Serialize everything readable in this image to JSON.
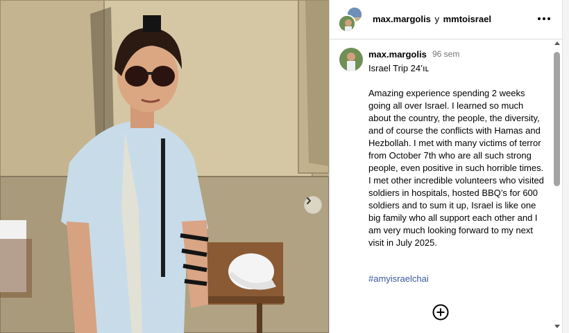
{
  "header": {
    "user1": "max.margolis",
    "conjunction": "y",
    "user2": "mmtoisrael"
  },
  "post": {
    "author": "max.margolis",
    "time": "96 sem",
    "title": "Israel Trip 24’ıʟ",
    "body": "Amazing experience spending 2 weeks going all over Israel. I learned so much about the country, the people, the diversity, and of course the conflicts with Hamas and Hezbollah. I met with many victims of terror from October 7th who are all such strong people, even positive in such horrible times. I met other incredible volunteers who visited soldiers in hospitals, hosted BBQ’s for 600 soldiers and to sum it up, Israel is like one big family who all support each other and I am very much looking forward to my next visit in July 2025.",
    "hashtag": "#amyisraelchai"
  },
  "icons": {
    "more": "more-horizontal-icon",
    "next": "chevron-right-icon",
    "add": "plus-circle-icon"
  },
  "colors": {
    "hashtag": "#385898",
    "secondary_text": "#737373",
    "divider": "#dbdbdb"
  }
}
